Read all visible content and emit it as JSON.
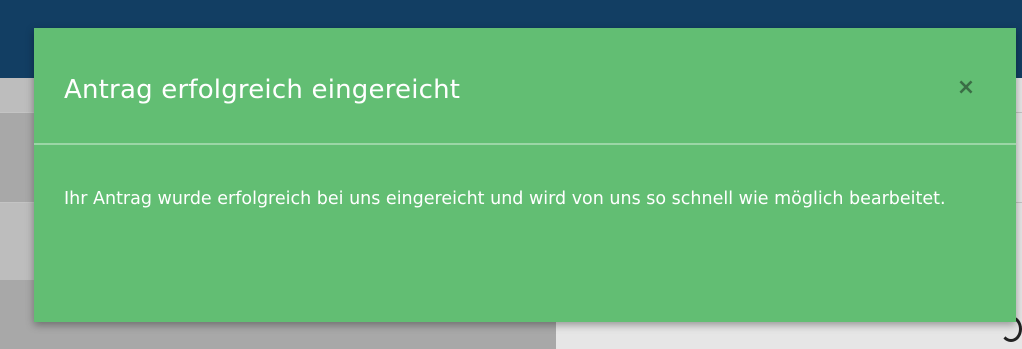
{
  "dialog": {
    "title": "Antrag erfolgreich eingereicht",
    "close_icon": "close-icon",
    "close_glyph": "×",
    "message": "Ihr Antrag wurde erfolgreich bei uns eingereicht und wird von uns so schnell wie möglich bearbeitet."
  },
  "colors": {
    "header_bar": "#123e63",
    "dialog_background": "#62be73",
    "dialog_text": "#ffffff",
    "close_icon": "#3a6e45"
  }
}
